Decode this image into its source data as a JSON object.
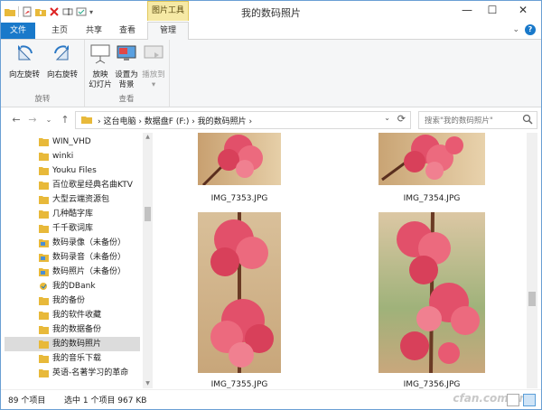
{
  "window": {
    "title": "我的数码照片",
    "context_tab": "图片工具",
    "controls": {
      "minimize": "—",
      "maximize": "☐",
      "close": "✕"
    }
  },
  "tabs": {
    "file": "文件",
    "home": "主页",
    "share": "共享",
    "view": "查看",
    "manage": "管理",
    "expand": "⌄",
    "help": "?"
  },
  "ribbon": {
    "rotate_group": {
      "label": "旋转",
      "rotate_left": "向左旋转",
      "rotate_right": "向右旋转"
    },
    "view_group": {
      "label": "查看",
      "slideshow_line1": "放映",
      "slideshow_line2": "幻灯片",
      "set_bg_line1": "设置为",
      "set_bg_line2": "背景",
      "cast_line1": "播放到",
      "cast_line2": "▾"
    }
  },
  "address": {
    "back": "←",
    "forward": "→",
    "recent": "⌄",
    "up": "↑",
    "crumbs": "›  这台电脑  ›  数据盘F (F:)  ›  我的数码照片  ›",
    "dropdown": "⌄",
    "refresh": "⟳"
  },
  "search": {
    "placeholder": "搜索\"我的数码照片\""
  },
  "nav": [
    {
      "label": "WIN_VHD",
      "type": "folder"
    },
    {
      "label": "winki",
      "type": "folder"
    },
    {
      "label": "Youku Files",
      "type": "folder"
    },
    {
      "label": "百位歌星经典名曲KTV",
      "type": "folder"
    },
    {
      "label": "大型云端资源包",
      "type": "folder"
    },
    {
      "label": "几种酷字库",
      "type": "folder"
    },
    {
      "label": "千千歌词库",
      "type": "folder"
    },
    {
      "label": "数码录像（未备份）",
      "type": "library"
    },
    {
      "label": "数码录音（未备份）",
      "type": "library"
    },
    {
      "label": "数码照片（未备份）",
      "type": "library"
    },
    {
      "label": "我的DBank",
      "type": "special"
    },
    {
      "label": "我的备份",
      "type": "folder"
    },
    {
      "label": "我的软件收藏",
      "type": "folder"
    },
    {
      "label": "我的数据备份",
      "type": "folder"
    },
    {
      "label": "我的数码照片",
      "type": "folder",
      "selected": true
    },
    {
      "label": "我的音乐下载",
      "type": "folder"
    },
    {
      "label": "英语-名著学习的革命",
      "type": "folder"
    }
  ],
  "files": [
    {
      "name": "IMG_7353.JPG"
    },
    {
      "name": "IMG_7354.JPG"
    },
    {
      "name": "IMG_7355.JPG"
    },
    {
      "name": "IMG_7356.JPG"
    }
  ],
  "status": {
    "count": "89 个项目",
    "selected": "选中 1 个项目  967 KB",
    "watermark": "cfan.com.cn"
  },
  "colors": {
    "accent": "#1979ca",
    "context_tab": "#f6e9a5",
    "folder": "#e8b93a",
    "selection": "#dcdcdc"
  }
}
